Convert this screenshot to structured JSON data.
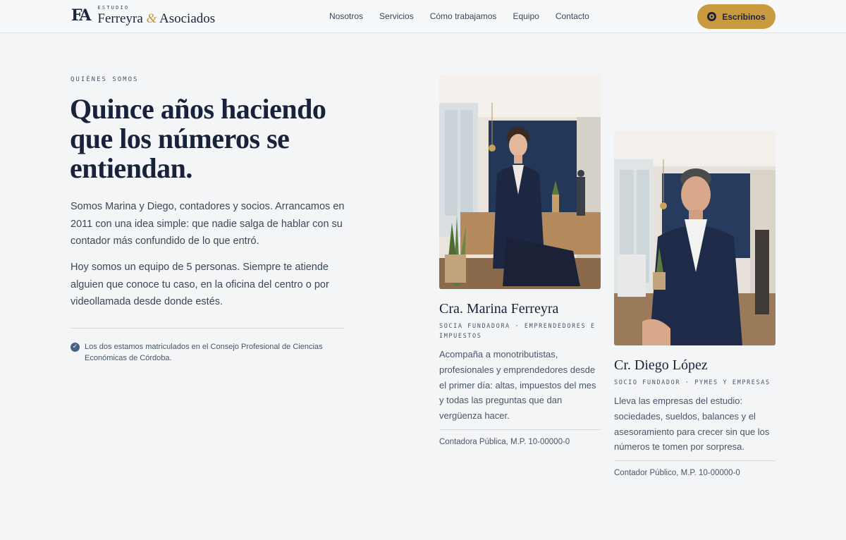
{
  "header": {
    "logo_mark": "FA",
    "logo_small": "ESTUDIO",
    "logo_name_1": "Ferreyra",
    "logo_amp": "&",
    "logo_name_2": "Asociados",
    "nav": [
      "Nosotros",
      "Servicios",
      "Cómo trabajamos",
      "Equipo",
      "Contacto"
    ],
    "cta_label": "Escribinos",
    "cta_icon": "whatsapp-icon"
  },
  "about": {
    "eyebrow": "QUIÉNES SOMOS",
    "headline": "Quince años haciendo que los números se entiendan.",
    "paragraph_1": "Somos Marina y Diego, contadores y socios. Arrancamos en 2011 con una idea simple: que nadie salga de hablar con su contador más confundido de lo que entró.",
    "paragraph_2": "Hoy somos un equipo de 5 personas. Siempre te atiende alguien que conoce tu caso, en la oficina del centro o por videollamada desde donde estés.",
    "note_icon": "check-badge-icon",
    "note": "Los dos estamos matriculados en el Consejo Profesional de Ciencias Económicas de Córdoba."
  },
  "team": [
    {
      "name": "Cra. Marina Ferreyra",
      "role": "SOCIA FUNDADORA · EMPRENDEDORES E IMPUESTOS",
      "description": "Acompaña a monotributistas, profesionales y emprendedores desde el primer día: altas, impuestos del mes y todas las preguntas que dan vergüenza hacer.",
      "license": "Contadora Pública, M.P. 10-00000-0"
    },
    {
      "name": "Cr. Diego López",
      "role": "SOCIO FUNDADOR · PYMES Y EMPRESAS",
      "description": "Lleva las empresas del estudio: sociedades, sueldos, balances y el asesoramiento para crecer sin que los números te tomen por sorpresa.",
      "license": "Contador Público, M.P. 10-00000-0"
    }
  ],
  "colors": {
    "accent": "#c99a3f",
    "navy": "#18223a",
    "background": "#f3f5f7"
  }
}
